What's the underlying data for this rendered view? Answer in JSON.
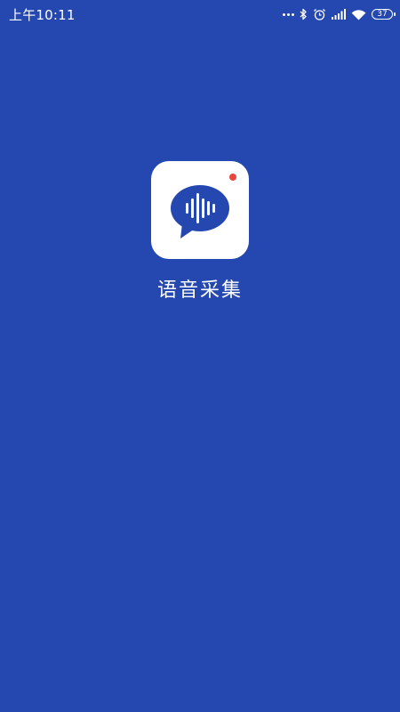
{
  "status_bar": {
    "time": "上午10:11",
    "icons": [
      "more-dots-icon",
      "bluetooth-icon",
      "alarm-icon",
      "signal-icon",
      "wifi-icon",
      "battery-icon"
    ],
    "battery_level": "37"
  },
  "splash": {
    "app_name": "语音采集",
    "icon": "voice-chat-bubble-icon"
  },
  "colors": {
    "background": "#2547b0",
    "icon_background": "#ffffff",
    "icon_accent": "#2547b0",
    "notify_dot": "#e8473f",
    "text": "#ffffff"
  }
}
